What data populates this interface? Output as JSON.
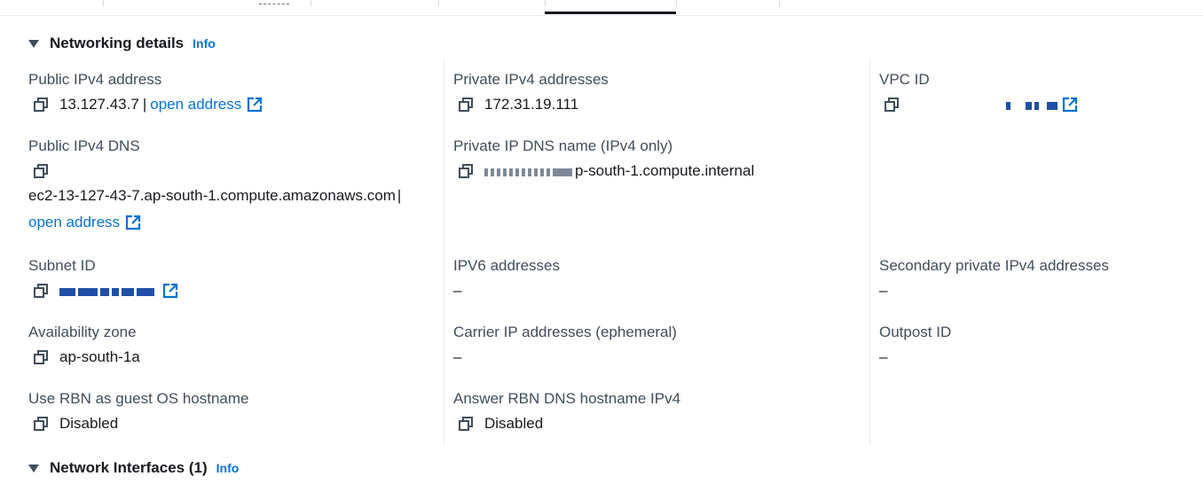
{
  "tabs": {
    "active_index": 4
  },
  "networking_section": {
    "title": "Networking details",
    "info": "Info"
  },
  "fields": {
    "public_ipv4": {
      "label": "Public IPv4 address",
      "value": "13.127.43.7",
      "link": "open address"
    },
    "public_ipv4_dns": {
      "label": "Public IPv4 DNS",
      "value": "ec2-13-127-43-7.ap-south-1.compute.amazonaws.com",
      "link": "open address"
    },
    "subnet_id": {
      "label": "Subnet ID"
    },
    "availability_zone": {
      "label": "Availability zone",
      "value": "ap-south-1a"
    },
    "use_rbn": {
      "label": "Use RBN as guest OS hostname",
      "value": "Disabled"
    },
    "private_ipv4": {
      "label": "Private IPv4 addresses",
      "value": "172.31.19.111"
    },
    "private_ip_dns": {
      "label": "Private IP DNS name (IPv4 only)",
      "value_suffix": "p-south-1.compute.internal"
    },
    "ipv6": {
      "label": "IPV6 addresses",
      "value": "–"
    },
    "carrier_ip": {
      "label": "Carrier IP addresses (ephemeral)",
      "value": "–"
    },
    "answer_rbn": {
      "label": "Answer RBN DNS hostname IPv4",
      "value": "Disabled"
    },
    "vpc_id": {
      "label": "VPC ID"
    },
    "secondary_private_ipv4": {
      "label": "Secondary private IPv4 addresses",
      "value": "–"
    },
    "outpost_id": {
      "label": "Outpost ID",
      "value": "–"
    }
  },
  "network_interfaces_section": {
    "title": "Network Interfaces (1)",
    "info": "Info"
  },
  "colors": {
    "link": "#0972d3",
    "label": "#414d5c",
    "text": "#16191f"
  }
}
